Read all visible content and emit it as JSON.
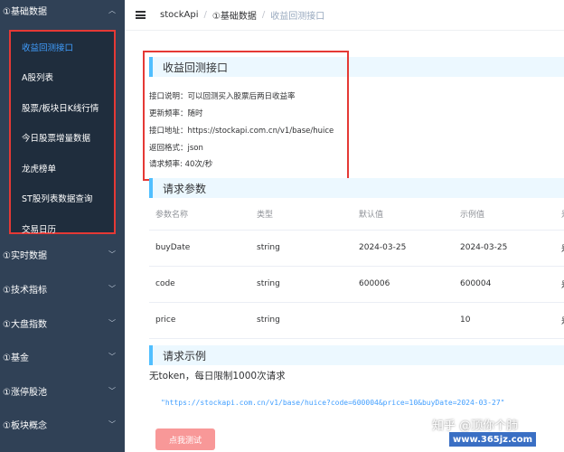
{
  "sidebar": {
    "top_menu": "①基础数据",
    "submenu": [
      {
        "label": "收益回测接口",
        "active": true
      },
      {
        "label": "A股列表"
      },
      {
        "label": "股票/板块日K线行情"
      },
      {
        "label": "今日股票增量数据"
      },
      {
        "label": "龙虎榜单"
      },
      {
        "label": "ST股列表数据查询"
      },
      {
        "label": "交易日历"
      }
    ],
    "groups": [
      "①实时数据",
      "①技术指标",
      "①大盘指数",
      "①基金",
      "①涨停股池",
      "①板块概念"
    ]
  },
  "breadcrumb": [
    "stockApi",
    "①基础数据",
    "收益回测接口"
  ],
  "api": {
    "title": "收益回测接口",
    "description": "接口说明：可以回测买入股票后两日收益率",
    "frequency": "更新频率：随时",
    "address": "接口地址：https://stockapi.com.cn/v1/base/huice",
    "format": "返回格式：json",
    "rate": "请求频率: 40次/秒"
  },
  "params": {
    "title": "请求参数",
    "headers": [
      "参数名称",
      "类型",
      "默认值",
      "示例值",
      "是"
    ],
    "rows": [
      [
        "buyDate",
        "string",
        "2024-03-25",
        "2024-03-25",
        "是"
      ],
      [
        "code",
        "string",
        "600006",
        "600004",
        "是"
      ],
      [
        "price",
        "string",
        "",
        "10",
        "是"
      ]
    ]
  },
  "example": {
    "title": "请求示例",
    "limit_text": "无token，每日限制1000次请求",
    "url": "\"https://stockapi.com.cn/v1/base/huice?code=600004&price=10&buyDate=2024-03-27\"",
    "button": "点我测试"
  },
  "watermark": {
    "text": "知乎 @顶你个肺",
    "badge": "www.365jz.com"
  }
}
